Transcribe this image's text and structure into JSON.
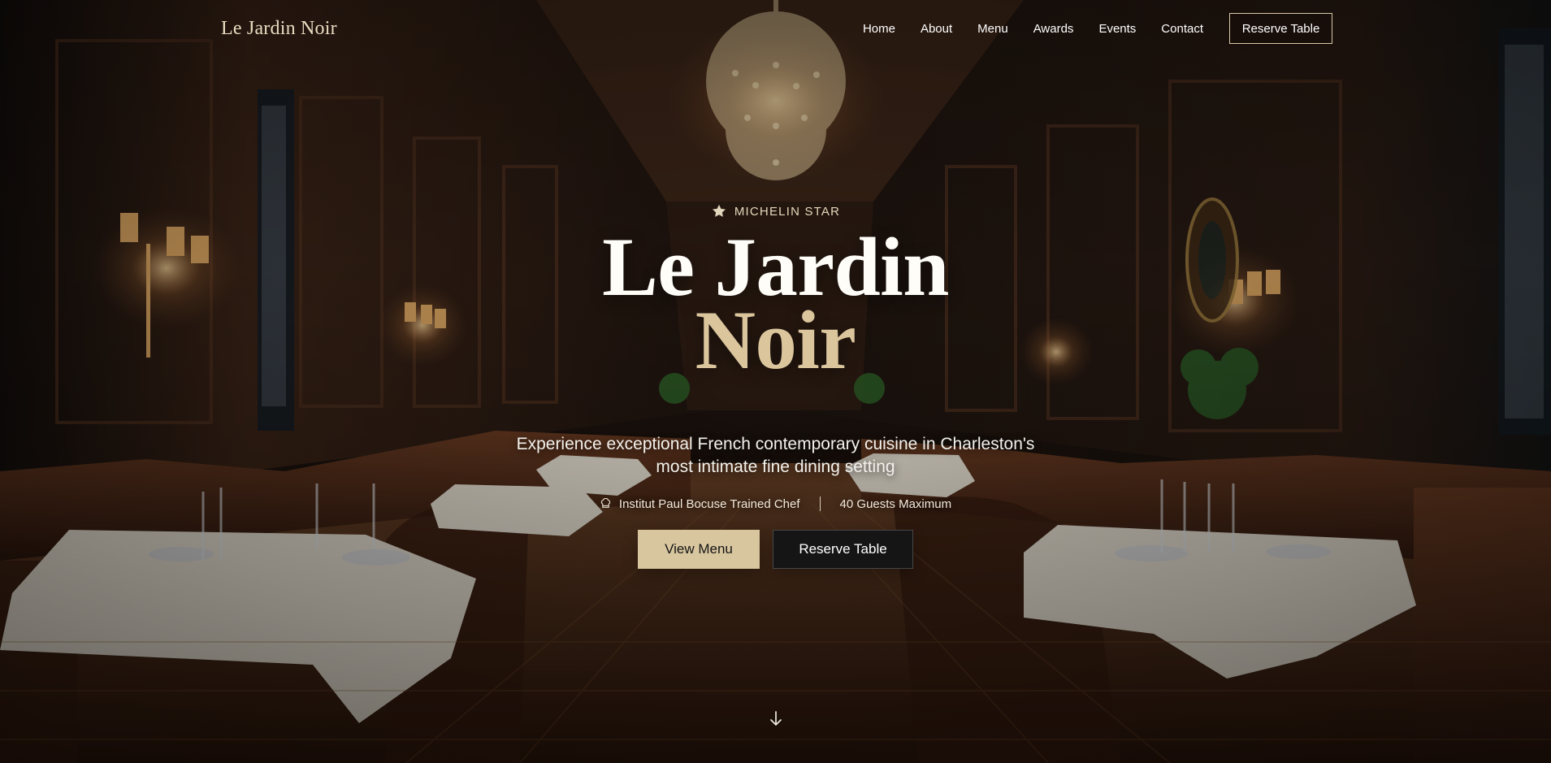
{
  "nav": {
    "brand": "Le Jardin Noir",
    "items": [
      "Home",
      "About",
      "Menu",
      "Awards",
      "Events",
      "Contact"
    ],
    "cta": "Reserve Table"
  },
  "hero": {
    "badge": "MICHELIN STAR",
    "title_line_1": "Le Jardin",
    "title_line_2": "Noir",
    "subtitle": "Experience exceptional French contemporary cuisine in Charleston's most intimate fine dining setting",
    "facts": [
      "Institut Paul Bocuse Trained Chef",
      "40 Guests Maximum"
    ],
    "primary_button": "View Menu",
    "secondary_button": "Reserve Table"
  },
  "icons": {
    "badge": "star-icon",
    "chef": "chef-hat-icon",
    "scroll": "arrow-down-icon"
  },
  "colors": {
    "accent": "#d8c69f",
    "title_primary": "#fffdf8",
    "title_accent": "#dbc59d",
    "button_dark": "#151515"
  }
}
